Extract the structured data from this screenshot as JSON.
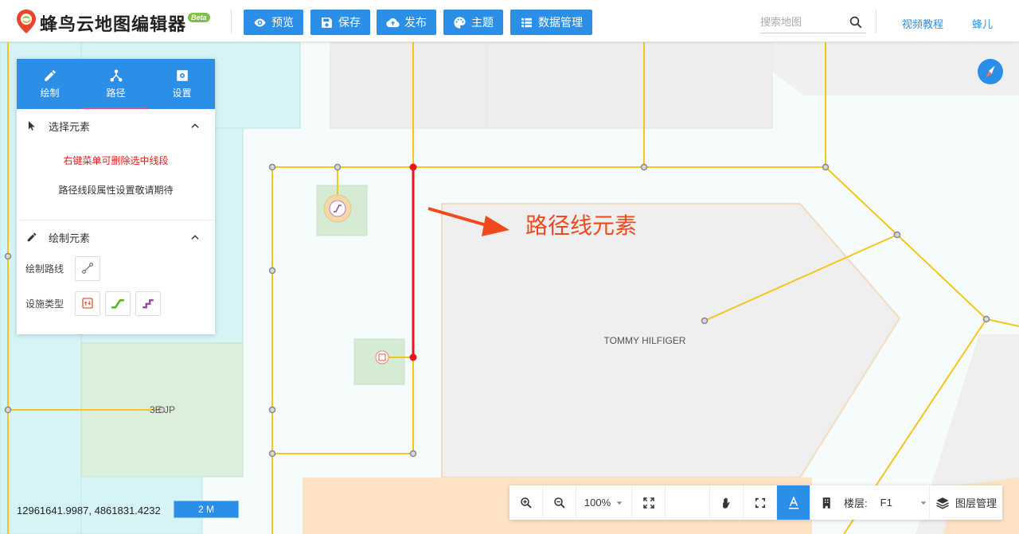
{
  "header": {
    "app_title": "蜂鸟云地图编辑器",
    "beta_badge": "Beta",
    "buttons": {
      "preview": "预览",
      "save": "保存",
      "publish": "发布",
      "theme": "主题",
      "data_manage": "数据管理"
    },
    "search_placeholder": "搜索地图",
    "video_tutorial": "视频教程",
    "user": "蜂儿"
  },
  "panel": {
    "tabs": [
      {
        "label": "绘制",
        "icon": "pencil-icon"
      },
      {
        "label": "路径",
        "icon": "path-nodes-icon"
      },
      {
        "label": "设置",
        "icon": "settings-icon"
      }
    ],
    "active_tab": "路径",
    "select_section": {
      "title": "选择元素",
      "warning": "右键菜单可删除选中线段",
      "info": "路径线段属性设置敬请期待"
    },
    "draw_section": {
      "title": "绘制元素",
      "draw_route_label": "绘制路线",
      "facility_type_label": "设施类型"
    }
  },
  "map": {
    "store_label": "TOMMY HILFIGER",
    "shop_label": "3E JP",
    "annotation": "路径线元素",
    "path_color": "#f5c518",
    "selected_color": "#e8161b"
  },
  "status": {
    "coordinates": "12961641.9987, 4861831.4232",
    "scale": "2 M"
  },
  "toolbar": {
    "zoom_level": "100%",
    "floor_label": "楼层:",
    "floor_value": "F1",
    "layer_manage": "图层管理"
  }
}
